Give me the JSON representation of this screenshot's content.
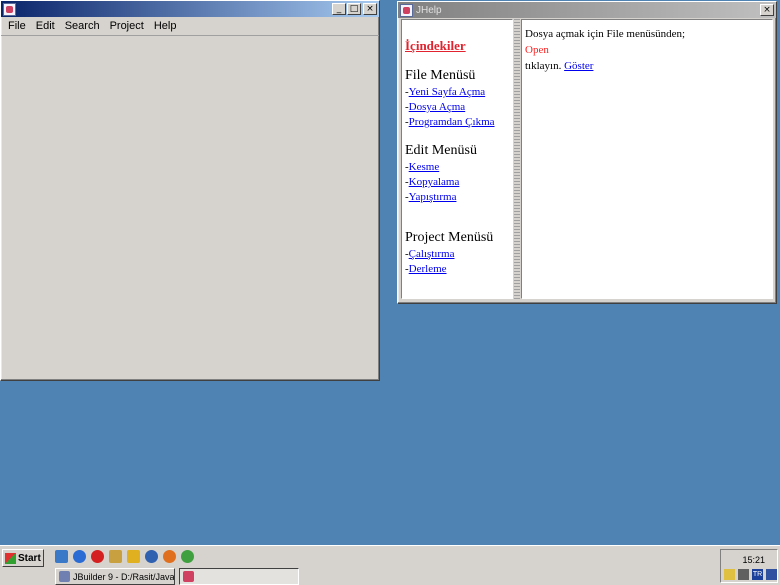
{
  "editor_window": {
    "title": "",
    "menu": [
      "File",
      "Edit",
      "Search",
      "Project",
      "Help"
    ]
  },
  "help_window": {
    "title": "JHelp",
    "toc": {
      "title": "İçindekiler",
      "sections": [
        {
          "heading": "File Menüsü",
          "links": [
            "Yeni Sayfa Açma",
            "Dosya Açma",
            "Programdan Çıkma"
          ]
        },
        {
          "heading": "Edit Menüsü",
          "links": [
            "Kesme",
            "Kopyalama",
            "Yapıştırma"
          ]
        },
        {
          "heading": "Project Menüsü",
          "links": [
            "Çalıştırma",
            "Derleme"
          ]
        }
      ],
      "bullet": "-"
    },
    "content": {
      "line1": "Dosya açmak için File menüsünden;",
      "line2": "Open",
      "line3_prefix": "tıklayın.",
      "line3_link": "Göster"
    }
  },
  "taskbar": {
    "start_label": "Start",
    "tasks": [
      "JBuilder 9 - D:/Rasit/Java/...",
      ""
    ],
    "clock": "15:21",
    "lang_badge": "TR"
  },
  "window_buttons": {
    "minimize": "_",
    "maximize": "□",
    "close": "×"
  }
}
